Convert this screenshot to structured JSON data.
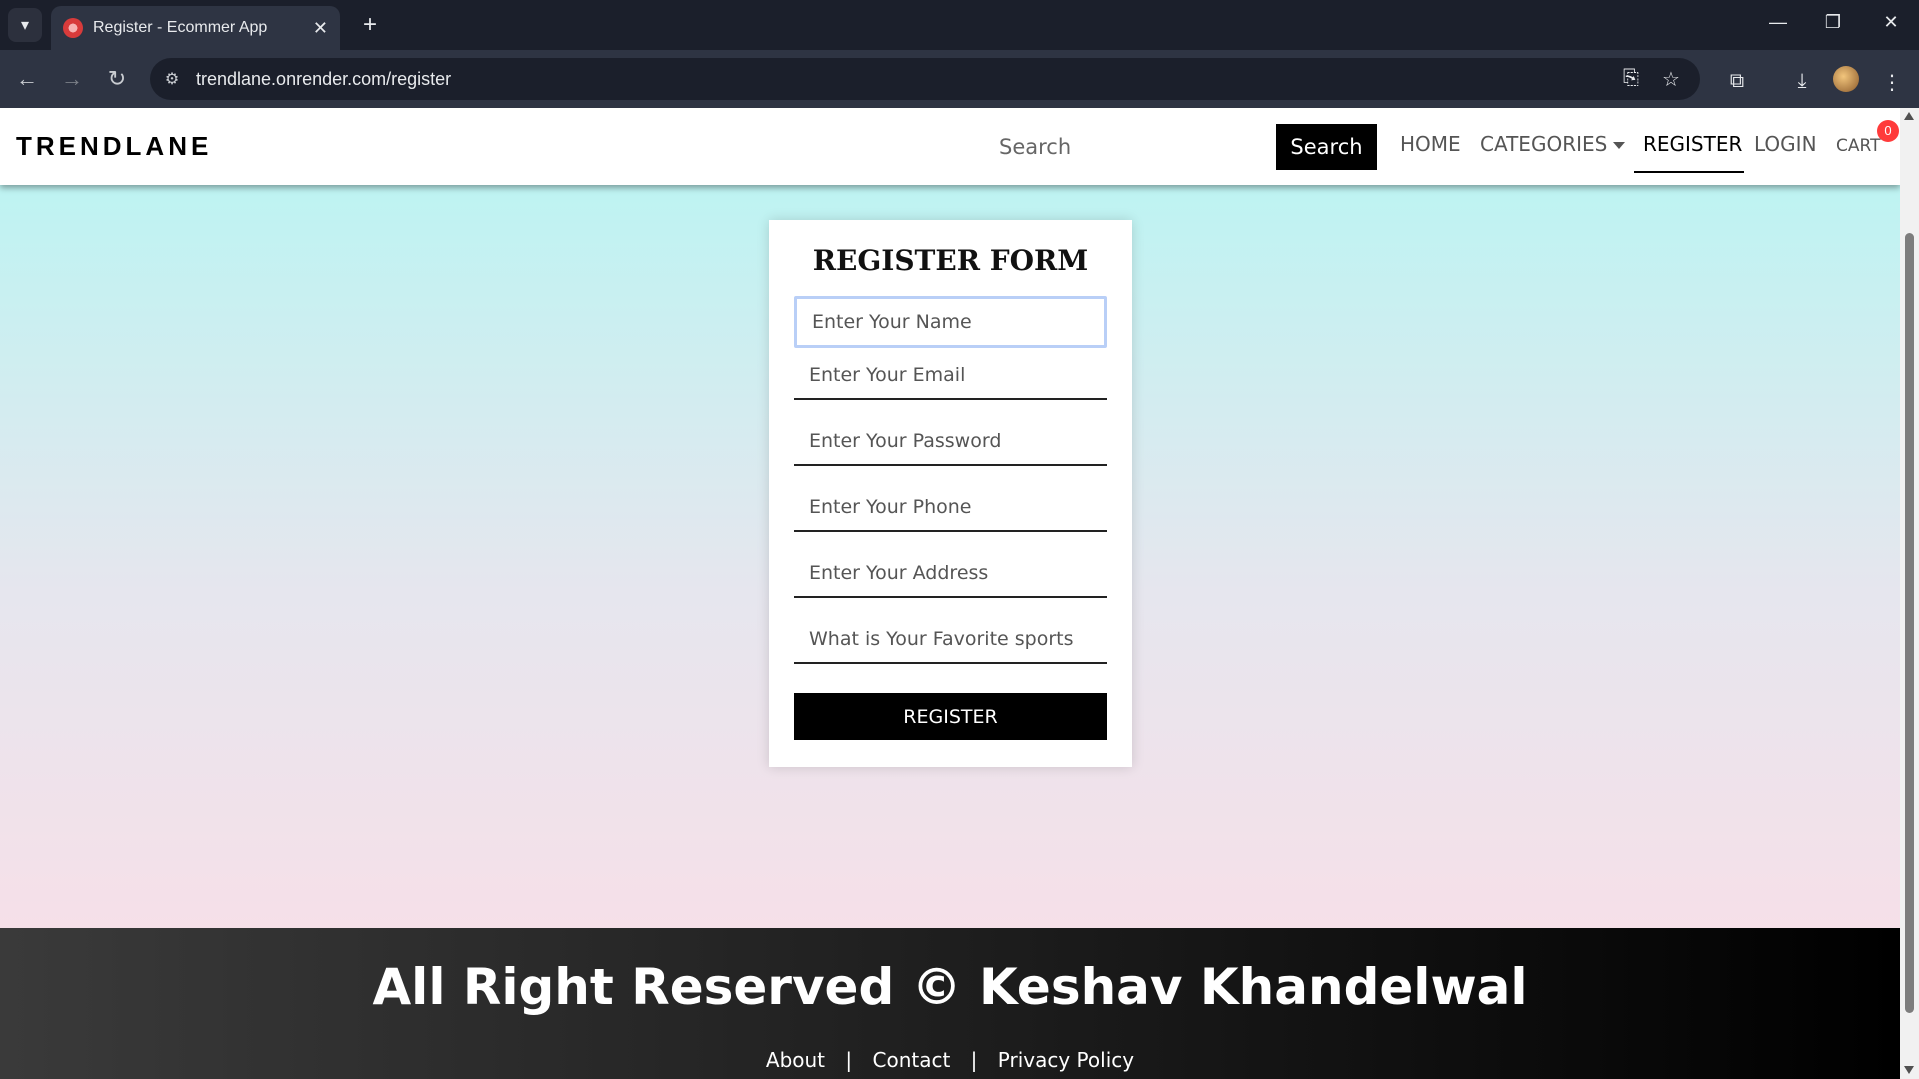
{
  "browser": {
    "tab_title": "Register - Ecommer App",
    "url": "trendlane.onrender.com/register",
    "new_tab": "+",
    "tab_close": "✕"
  },
  "site": {
    "brand": "TRENDLANE",
    "search_placeholder": "Search",
    "search_button": "Search",
    "nav": {
      "home": "HOME",
      "categories": "CATEGORIES",
      "register": "REGISTER",
      "login": "LOGIN",
      "cart": "CART",
      "cart_count": "0"
    }
  },
  "form": {
    "title": "REGISTER FORM",
    "name_placeholder": "Enter Your Name",
    "email_placeholder": "Enter Your Email",
    "password_placeholder": "Enter Your Password",
    "phone_placeholder": "Enter Your Phone",
    "address_placeholder": "Enter Your Address",
    "sports_placeholder": "What is Your Favorite sports",
    "submit": "REGISTER"
  },
  "footer": {
    "text": "All Right Reserved © Keshav Khandelwal",
    "links": {
      "about": "About",
      "contact": "Contact",
      "privacy": "Privacy Policy",
      "separator": "|"
    }
  },
  "colors": {
    "gradient_top": "#b6f6f3",
    "gradient_bottom": "#fddde6",
    "cart_badge": "#ff3b3b"
  }
}
